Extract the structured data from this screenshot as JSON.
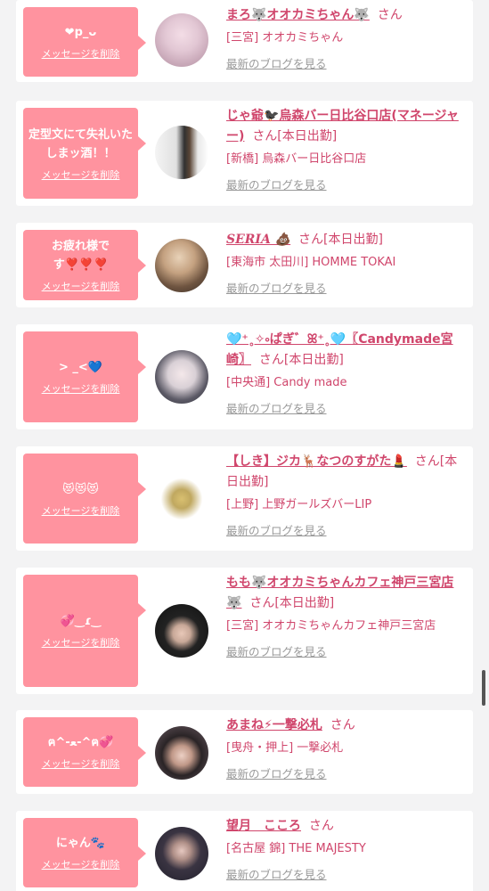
{
  "delete_label": "メッセージを削除",
  "blog_label": "最新のブログを見る",
  "entries": [
    {
      "message": "❤p_ᴗ",
      "name": "まろ🐺オオカミちゃん🐺",
      "suffix": "さん",
      "shop": "[三宮] オオカミちゃん"
    },
    {
      "message": "定型文にて失礼いたしまッ酒！！",
      "name": "じゃ爺🐦‍⬛烏森バー日比谷口店(マネージャー)",
      "suffix": "さん[本日出勤]",
      "shop": "[新橋] 烏森バー日比谷口店"
    },
    {
      "message": "お疲れ様です❣️❣️❣️",
      "name": "SERIA 💩",
      "suffix": "さん[本日出勤]",
      "shop": "[東海市 太田川] HOMME TOKAI"
    },
    {
      "message": "> _<💙",
      "name": "🩵⁺˳✧༚ぱぎ゛ꕤ⁺˳🩵〖Candymade宮崎〗",
      "suffix": "さん[本日出勤]",
      "shop": "[中央通] Candy made"
    },
    {
      "message": "😻😻😻",
      "name": "【しき】ジカ🦌なつのすがた💄",
      "suffix": "さん[本日出勤]",
      "shop": "[上野] 上野ガールズバーLIP"
    },
    {
      "message": "💞‿ɾ‿",
      "name": "もも🐺オオカミちゃんカフェ神戸三宮店🐺",
      "suffix": "さん[本日出勤]",
      "shop": "[三宮] オオカミちゃんカフェ神戸三宮店"
    },
    {
      "message": "ฅ^-ﻌ-^ฅ💞",
      "name": "あまね⚡一撃必札",
      "suffix": "さん",
      "shop": "[曳舟・押上] 一撃必札"
    },
    {
      "message": "にゃん🐾",
      "name": "望月　こころ",
      "suffix": "さん",
      "shop": "[名古屋 錦] THE MAJESTY"
    }
  ]
}
